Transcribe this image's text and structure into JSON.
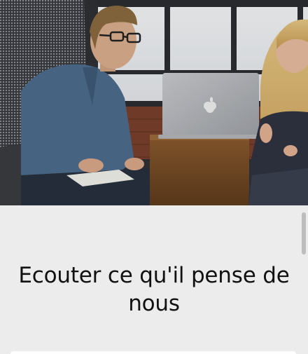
{
  "hero": {
    "image_semantic": "two-people-meeting-laptop-photo"
  },
  "section": {
    "headline": "Ecouter ce qu'il pense de nous"
  },
  "colors": {
    "page_background": "#ececec",
    "headline_text": "#111111",
    "card_background": "#ffffff",
    "scrollbar_thumb": "#bdbdbd"
  }
}
